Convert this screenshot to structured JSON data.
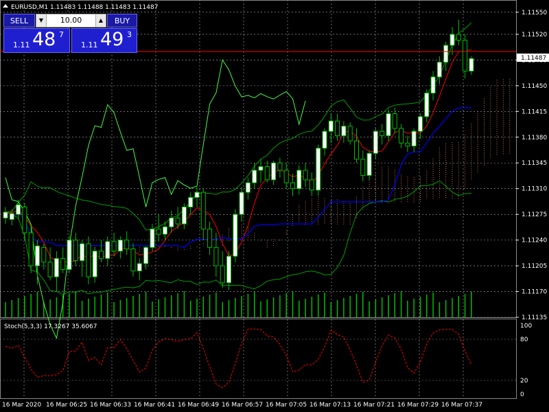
{
  "header": {
    "title": "EURUSD,M1  1.11483 1.11488 1.11483 1.11487"
  },
  "trade_panel": {
    "sell_label": "SELL",
    "buy_label": "BUY",
    "lot": "10.00",
    "sell_small": "1.11",
    "sell_big": "48",
    "sell_sup": "7",
    "buy_small": "1.11",
    "buy_big": "49",
    "buy_sup": "3"
  },
  "current_price_label": "1.11487",
  "stoch_title": "Stoch(5,3,3) 17.3267 35.6067",
  "price_axis": [
    "1.11550",
    "1.11520",
    "1.11485",
    "1.11450",
    "1.11415",
    "1.11380",
    "1.11345",
    "1.11310",
    "1.11275",
    "1.11240",
    "1.11205",
    "1.11170",
    "1.11135"
  ],
  "stoch_axis": [
    "100",
    "80",
    "20",
    "0"
  ],
  "time_axis": [
    "16 Mar 2020",
    "16 Mar 06:25",
    "16 Mar 06:33",
    "16 Mar 06:41",
    "16 Mar 06:49",
    "16 Mar 06:57",
    "16 Mar 07:05",
    "16 Mar 07:13",
    "16 Mar 07:21",
    "16 Mar 07:29",
    "16 Mar 07:37"
  ],
  "colors": {
    "background": "#000000",
    "grid": "#ffffff",
    "candle_up": "#ffffff",
    "candle_wick": "#00c000",
    "bands": "#00a000",
    "outer_band": "#40ff40",
    "ma_red": "#ff0000",
    "ma_blue": "#0000ff",
    "volume": "#00c000",
    "stoch_line": "#ff0000",
    "cloud": "#ff9060",
    "current_price_line": "#ff0000",
    "panel_blue": "#1f1fd0"
  },
  "chart_data": {
    "type": "candlestick",
    "symbol": "EURUSD",
    "timeframe": "M1",
    "ylim": [
      1.11135,
      1.11562
    ],
    "current_price": 1.11487,
    "candles_ohlc": [
      [
        1.1127,
        1.11285,
        1.11262,
        1.11278
      ],
      [
        1.11268,
        1.11282,
        1.1126,
        1.11276
      ],
      [
        1.11275,
        1.11295,
        1.11268,
        1.11288
      ],
      [
        1.11285,
        1.1129,
        1.1124,
        1.1125
      ],
      [
        1.1125,
        1.1126,
        1.11195,
        1.11205
      ],
      [
        1.11205,
        1.1124,
        1.1118,
        1.11232
      ],
      [
        1.1123,
        1.11235,
        1.112,
        1.1121
      ],
      [
        1.1121,
        1.1123,
        1.11185,
        1.1119
      ],
      [
        1.1119,
        1.11225,
        1.1117,
        1.11215
      ],
      [
        1.11215,
        1.1123,
        1.11195,
        1.112
      ],
      [
        1.112,
        1.11245,
        1.11195,
        1.1124
      ],
      [
        1.1124,
        1.1125,
        1.11205,
        1.11212
      ],
      [
        1.11212,
        1.1124,
        1.1119,
        1.11235
      ],
      [
        1.11235,
        1.11245,
        1.1118,
        1.1119
      ],
      [
        1.1119,
        1.1123,
        1.11182,
        1.11225
      ],
      [
        1.11225,
        1.1124,
        1.1121,
        1.11215
      ],
      [
        1.11215,
        1.11245,
        1.11205,
        1.11238
      ],
      [
        1.11238,
        1.1125,
        1.11218,
        1.11225
      ],
      [
        1.11225,
        1.11245,
        1.11215,
        1.1124
      ],
      [
        1.1124,
        1.11252,
        1.1122,
        1.11228
      ],
      [
        1.11228,
        1.11236,
        1.1119,
        1.11198
      ],
      [
        1.11198,
        1.11215,
        1.11185,
        1.11208
      ],
      [
        1.11208,
        1.11232,
        1.112,
        1.1123
      ],
      [
        1.1123,
        1.11262,
        1.11225,
        1.11255
      ],
      [
        1.11255,
        1.11275,
        1.11238,
        1.11248
      ],
      [
        1.11248,
        1.11265,
        1.1124,
        1.11258
      ],
      [
        1.11258,
        1.1128,
        1.1125,
        1.1127
      ],
      [
        1.1127,
        1.11285,
        1.11255,
        1.11262
      ],
      [
        1.11262,
        1.1129,
        1.11255,
        1.11285
      ],
      [
        1.11285,
        1.11305,
        1.11275,
        1.11298
      ],
      [
        1.11298,
        1.11312,
        1.11285,
        1.11305
      ],
      [
        1.11305,
        1.1131,
        1.1124,
        1.11255
      ],
      [
        1.11255,
        1.11265,
        1.1122,
        1.1123
      ],
      [
        1.1123,
        1.1125,
        1.1119,
        1.11205
      ],
      [
        1.11205,
        1.11225,
        1.11175,
        1.11182
      ],
      [
        1.11182,
        1.11225,
        1.11172,
        1.11218
      ],
      [
        1.11218,
        1.11282,
        1.1121,
        1.11275
      ],
      [
        1.11275,
        1.11312,
        1.11265,
        1.11305
      ],
      [
        1.11305,
        1.11325,
        1.11295,
        1.11318
      ],
      [
        1.11318,
        1.11345,
        1.1131,
        1.11335
      ],
      [
        1.11335,
        1.1135,
        1.11318,
        1.1134
      ],
      [
        1.1134,
        1.11348,
        1.11318,
        1.11322
      ],
      [
        1.11322,
        1.11348,
        1.11315,
        1.11345
      ],
      [
        1.11345,
        1.11352,
        1.11325,
        1.11335
      ],
      [
        1.11335,
        1.11345,
        1.1131,
        1.11318
      ],
      [
        1.11318,
        1.1133,
        1.113,
        1.1131
      ],
      [
        1.1131,
        1.11342,
        1.11302,
        1.11335
      ],
      [
        1.11335,
        1.11345,
        1.11312,
        1.11322
      ],
      [
        1.11322,
        1.11332,
        1.113,
        1.11308
      ],
      [
        1.11308,
        1.1137,
        1.113,
        1.11365
      ],
      [
        1.11365,
        1.11392,
        1.11355,
        1.11388
      ],
      [
        1.11388,
        1.11412,
        1.11372,
        1.11402
      ],
      [
        1.11402,
        1.11412,
        1.11375,
        1.11382
      ],
      [
        1.11382,
        1.11402,
        1.11372,
        1.11395
      ],
      [
        1.11395,
        1.114,
        1.1137,
        1.11375
      ],
      [
        1.11375,
        1.11392,
        1.11345,
        1.1135
      ],
      [
        1.1135,
        1.11362,
        1.1132,
        1.11328
      ],
      [
        1.11328,
        1.11362,
        1.11322,
        1.11358
      ],
      [
        1.11358,
        1.11392,
        1.1135,
        1.11388
      ],
      [
        1.11388,
        1.11398,
        1.1137,
        1.11382
      ],
      [
        1.11382,
        1.11418,
        1.11375,
        1.11412
      ],
      [
        1.11412,
        1.1142,
        1.11385,
        1.11392
      ],
      [
        1.11392,
        1.11398,
        1.11365,
        1.11372
      ],
      [
        1.11372,
        1.11382,
        1.1136,
        1.11368
      ],
      [
        1.11368,
        1.11392,
        1.1136,
        1.11388
      ],
      [
        1.11388,
        1.11412,
        1.11378,
        1.11408
      ],
      [
        1.11408,
        1.11445,
        1.114,
        1.1144
      ],
      [
        1.1144,
        1.1147,
        1.1143,
        1.11462
      ],
      [
        1.11462,
        1.1149,
        1.11452,
        1.11482
      ],
      [
        1.11482,
        1.1151,
        1.1147,
        1.11505
      ],
      [
        1.11505,
        1.1153,
        1.11492,
        1.1152
      ],
      [
        1.1152,
        1.1154,
        1.11505,
        1.11512
      ],
      [
        1.11512,
        1.1152,
        1.1146,
        1.1147
      ],
      [
        1.1147,
        1.1149,
        1.11465,
        1.11487
      ]
    ],
    "stochastic": {
      "title": "Stoch(5,3,3)",
      "main": 17.3267,
      "signal": 35.6067,
      "levels": [
        20,
        80
      ],
      "ylim": [
        0,
        100
      ]
    }
  }
}
